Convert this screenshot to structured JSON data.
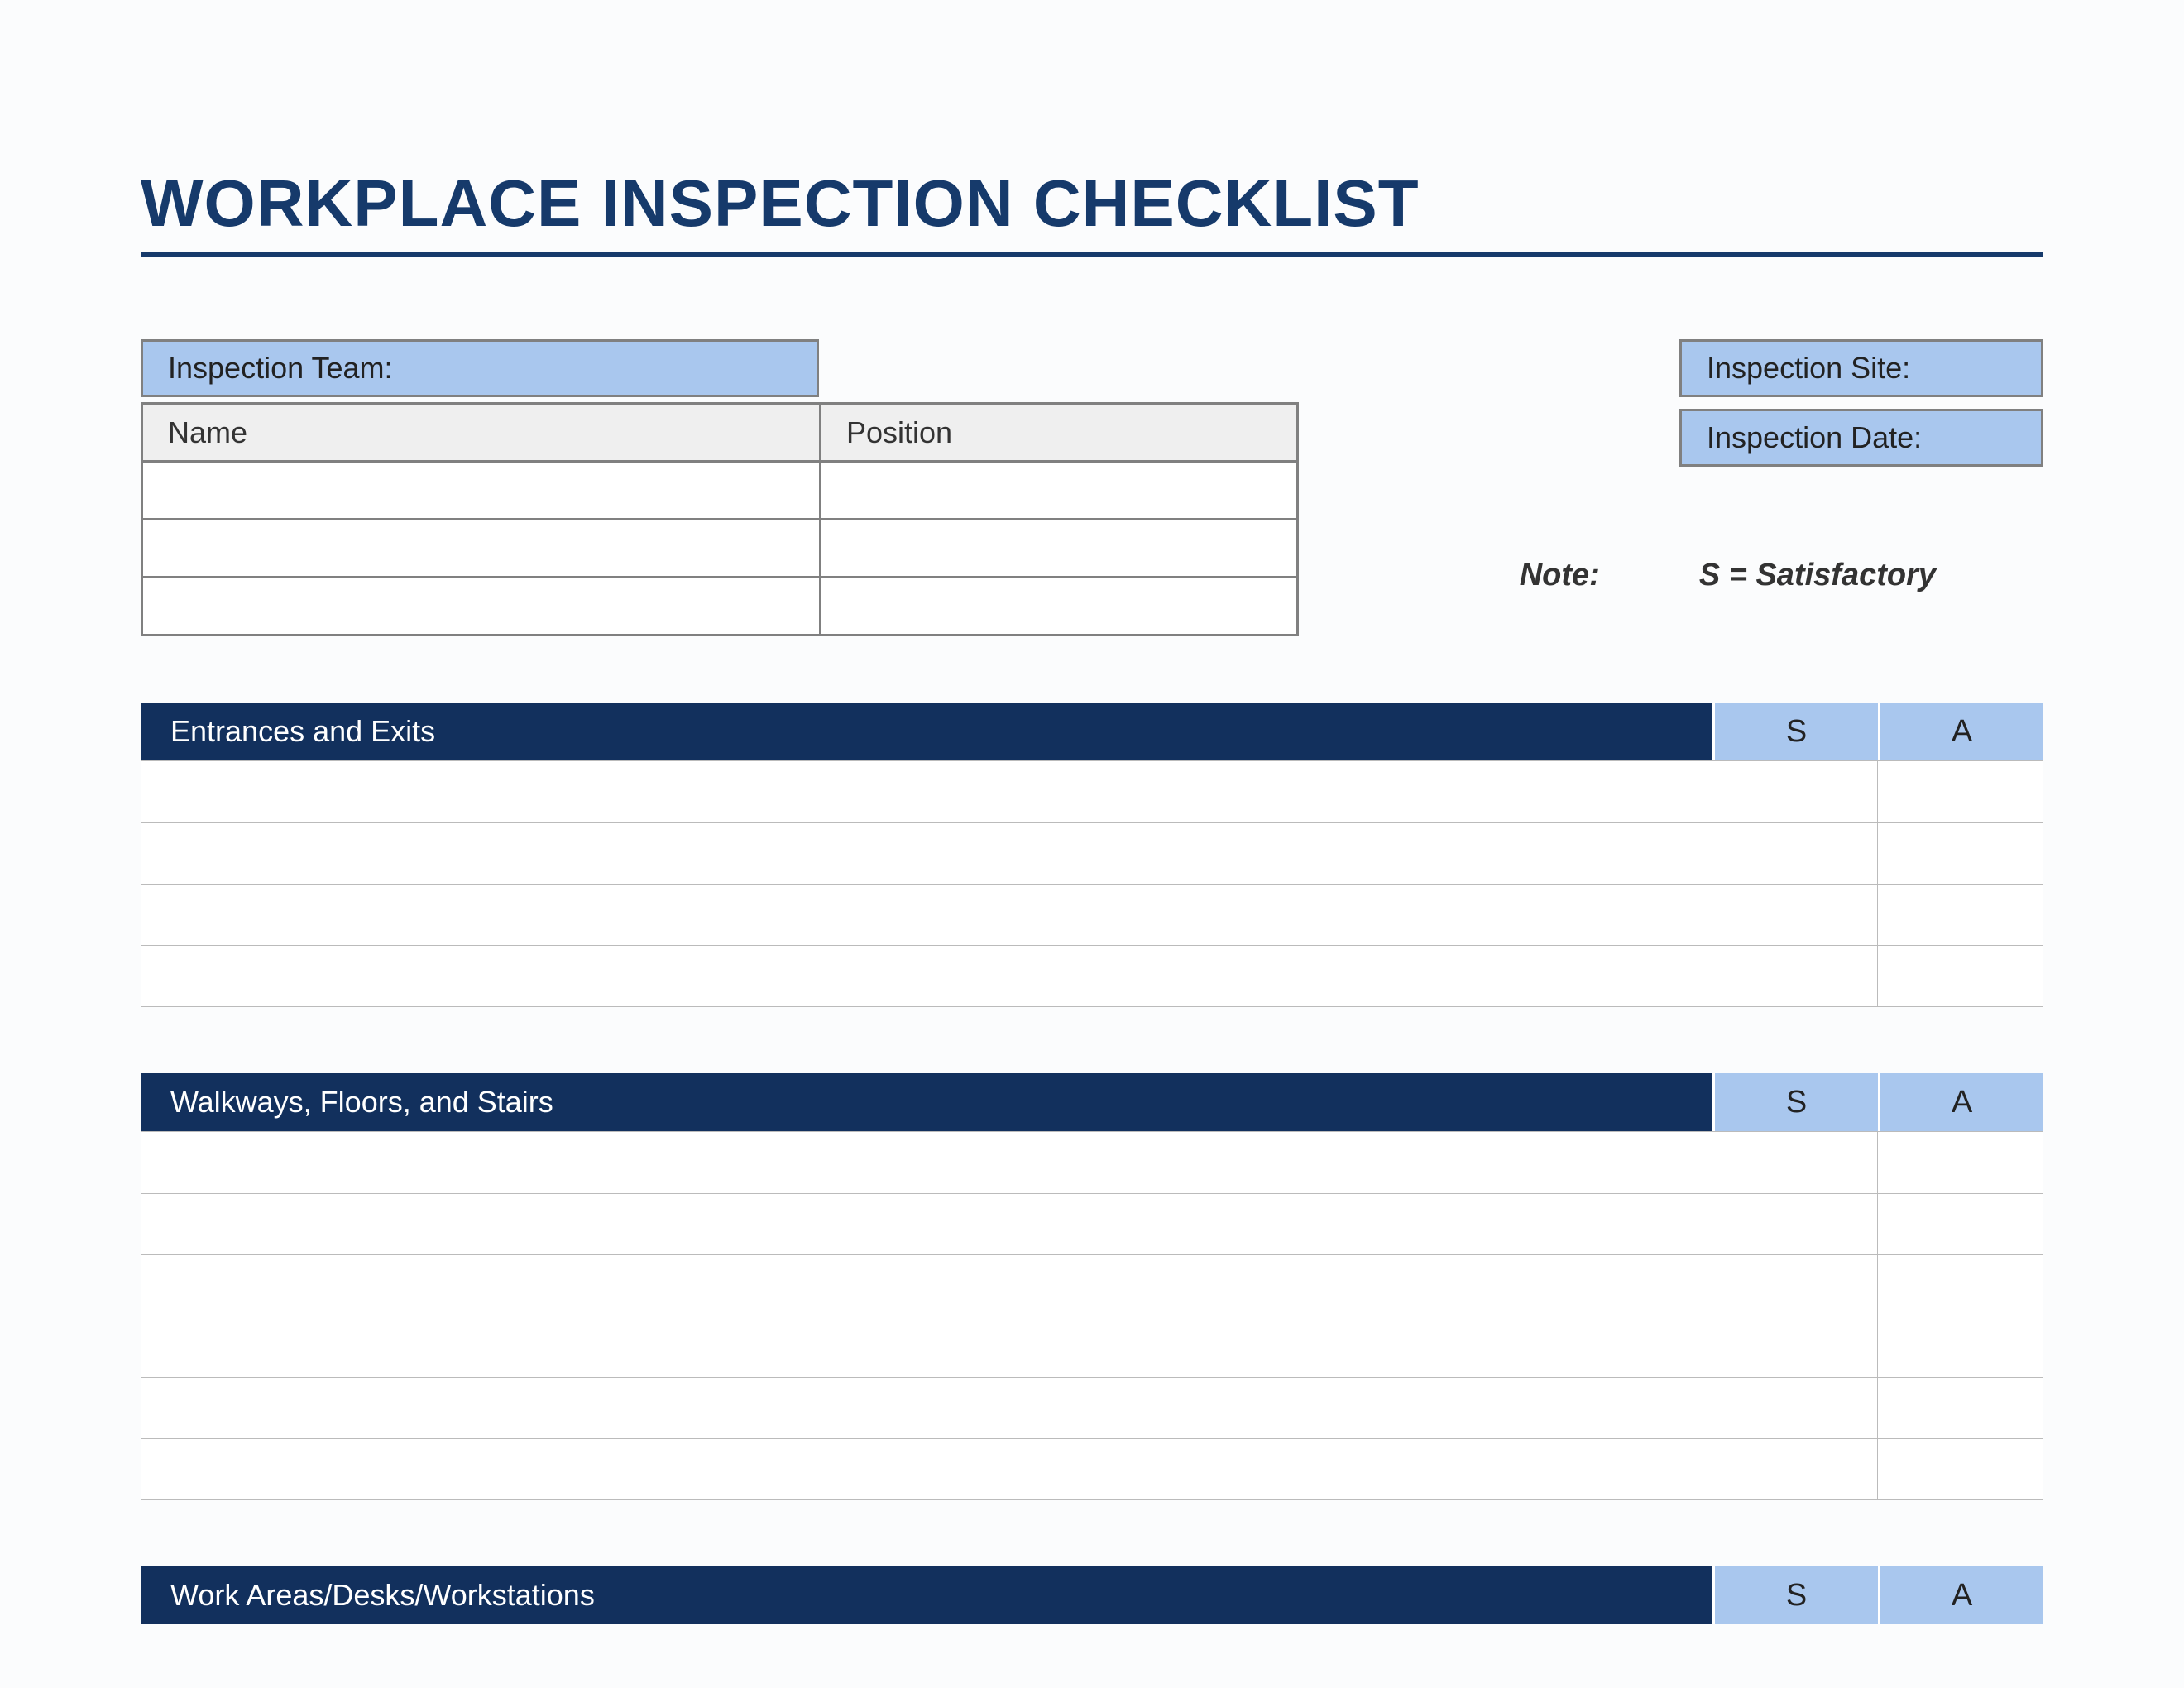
{
  "title": "WORKPLACE INSPECTION CHECKLIST",
  "info": {
    "team_label": "Inspection Team:",
    "name_header": "Name",
    "position_header": "Position",
    "site_label": "Inspection Site:",
    "date_label": "Inspection Date:"
  },
  "note": {
    "label": "Note:",
    "value": "S = Satisfactory"
  },
  "cols": {
    "s": "S",
    "a": "A"
  },
  "sections": [
    {
      "title": "Entrances and Exits",
      "rows": 4
    },
    {
      "title": "Walkways, Floors, and Stairs",
      "rows": 6
    },
    {
      "title": "Work Areas/Desks/Workstations",
      "rows": 0
    }
  ]
}
